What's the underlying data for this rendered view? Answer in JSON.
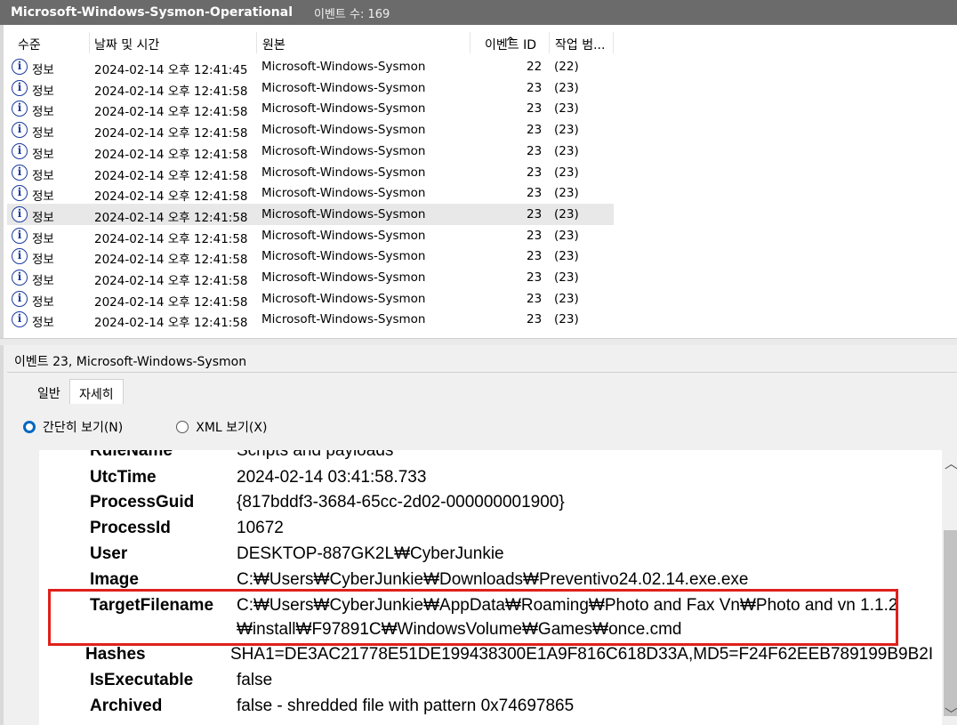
{
  "window": {
    "log_name": "Microsoft-Windows-Sysmon-Operational",
    "event_count": "이벤트 수: 169"
  },
  "table": {
    "columns": [
      "수준",
      "날짜 및 시간",
      "원본",
      "이벤트 ID",
      "작업 범..."
    ],
    "rows": [
      {
        "level": "정보",
        "datetime": "2024-02-14 오후 12:41:45",
        "source": "Microsoft-Windows-Sysmon",
        "id": "22",
        "task": "(22)"
      },
      {
        "level": "정보",
        "datetime": "2024-02-14 오후 12:41:58",
        "source": "Microsoft-Windows-Sysmon",
        "id": "23",
        "task": "(23)"
      },
      {
        "level": "정보",
        "datetime": "2024-02-14 오후 12:41:58",
        "source": "Microsoft-Windows-Sysmon",
        "id": "23",
        "task": "(23)"
      },
      {
        "level": "정보",
        "datetime": "2024-02-14 오후 12:41:58",
        "source": "Microsoft-Windows-Sysmon",
        "id": "23",
        "task": "(23)"
      },
      {
        "level": "정보",
        "datetime": "2024-02-14 오후 12:41:58",
        "source": "Microsoft-Windows-Sysmon",
        "id": "23",
        "task": "(23)"
      },
      {
        "level": "정보",
        "datetime": "2024-02-14 오후 12:41:58",
        "source": "Microsoft-Windows-Sysmon",
        "id": "23",
        "task": "(23)"
      },
      {
        "level": "정보",
        "datetime": "2024-02-14 오후 12:41:58",
        "source": "Microsoft-Windows-Sysmon",
        "id": "23",
        "task": "(23)"
      },
      {
        "level": "정보",
        "datetime": "2024-02-14 오후 12:41:58",
        "source": "Microsoft-Windows-Sysmon",
        "id": "23",
        "task": "(23)",
        "selected": true
      },
      {
        "level": "정보",
        "datetime": "2024-02-14 오후 12:41:58",
        "source": "Microsoft-Windows-Sysmon",
        "id": "23",
        "task": "(23)"
      },
      {
        "level": "정보",
        "datetime": "2024-02-14 오후 12:41:58",
        "source": "Microsoft-Windows-Sysmon",
        "id": "23",
        "task": "(23)"
      },
      {
        "level": "정보",
        "datetime": "2024-02-14 오후 12:41:58",
        "source": "Microsoft-Windows-Sysmon",
        "id": "23",
        "task": "(23)"
      },
      {
        "level": "정보",
        "datetime": "2024-02-14 오후 12:41:58",
        "source": "Microsoft-Windows-Sysmon",
        "id": "23",
        "task": "(23)"
      },
      {
        "level": "정보",
        "datetime": "2024-02-14 오후 12:41:58",
        "source": "Microsoft-Windows-Sysmon",
        "id": "23",
        "task": "(23)"
      }
    ]
  },
  "detail": {
    "title": "이벤트 23, Microsoft-Windows-Sysmon",
    "tabs": [
      "일반",
      "자세히"
    ],
    "view_options": [
      "간단히 보기(N)",
      "XML 보기(X)"
    ],
    "fields": [
      {
        "key": "RuleName",
        "value": "Scripts and payloads"
      },
      {
        "key": "UtcTime",
        "value": "2024-02-14 03:41:58.733"
      },
      {
        "key": "ProcessGuid",
        "value": "{817bddf3-3684-65cc-2d02-000000001900}"
      },
      {
        "key": "ProcessId",
        "value": "10672"
      },
      {
        "key": "User",
        "value": "DESKTOP-887GK2L₩CyberJunkie"
      },
      {
        "key": "Image",
        "value": "C:₩Users₩CyberJunkie₩Downloads₩Preventivo24.02.14.exe.exe"
      },
      {
        "key": "TargetFilename",
        "value": "C:₩Users₩CyberJunkie₩AppData₩Roaming₩Photo and Fax Vn₩Photo and vn 1.1.2",
        "value2": "₩install₩F97891C₩WindowsVolume₩Games₩once.cmd"
      },
      {
        "key": "Hashes",
        "value": "SHA1=DE3AC21778E51DE199438300E1A9F816C618D33A,MD5=F24F62EEB789199B9B2I"
      },
      {
        "key": "IsExecutable",
        "value": "false"
      },
      {
        "key": "Archived",
        "value": "false - shredded file with pattern 0x74697865"
      }
    ]
  },
  "icons": {
    "info": "info-icon",
    "scroll_up": "chevron-up-icon",
    "scroll_down": "chevron-down-icon"
  },
  "colors": {
    "title_bar": "#6b6b6b",
    "highlight_box": "#e0201c",
    "radio_selected": "#0067c0",
    "info_icon": "#1a3a9e"
  }
}
